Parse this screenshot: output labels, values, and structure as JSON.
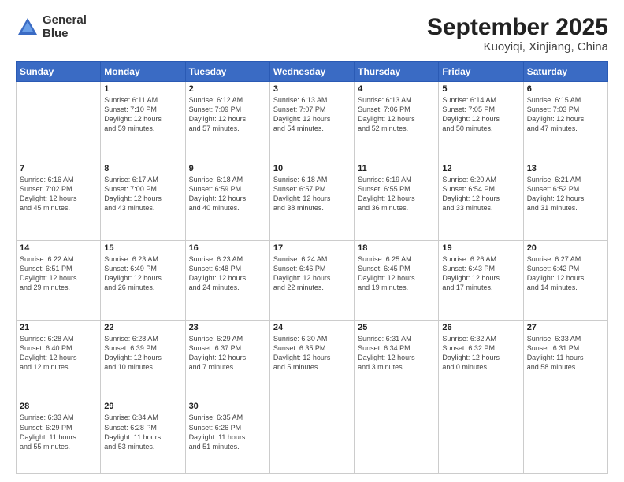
{
  "header": {
    "logo_line1": "General",
    "logo_line2": "Blue",
    "title": "September 2025",
    "subtitle": "Kuoyiqi, Xinjiang, China"
  },
  "days_of_week": [
    "Sunday",
    "Monday",
    "Tuesday",
    "Wednesday",
    "Thursday",
    "Friday",
    "Saturday"
  ],
  "weeks": [
    [
      {
        "day": "",
        "info": ""
      },
      {
        "day": "1",
        "info": "Sunrise: 6:11 AM\nSunset: 7:10 PM\nDaylight: 12 hours\nand 59 minutes."
      },
      {
        "day": "2",
        "info": "Sunrise: 6:12 AM\nSunset: 7:09 PM\nDaylight: 12 hours\nand 57 minutes."
      },
      {
        "day": "3",
        "info": "Sunrise: 6:13 AM\nSunset: 7:07 PM\nDaylight: 12 hours\nand 54 minutes."
      },
      {
        "day": "4",
        "info": "Sunrise: 6:13 AM\nSunset: 7:06 PM\nDaylight: 12 hours\nand 52 minutes."
      },
      {
        "day": "5",
        "info": "Sunrise: 6:14 AM\nSunset: 7:05 PM\nDaylight: 12 hours\nand 50 minutes."
      },
      {
        "day": "6",
        "info": "Sunrise: 6:15 AM\nSunset: 7:03 PM\nDaylight: 12 hours\nand 47 minutes."
      }
    ],
    [
      {
        "day": "7",
        "info": "Sunrise: 6:16 AM\nSunset: 7:02 PM\nDaylight: 12 hours\nand 45 minutes."
      },
      {
        "day": "8",
        "info": "Sunrise: 6:17 AM\nSunset: 7:00 PM\nDaylight: 12 hours\nand 43 minutes."
      },
      {
        "day": "9",
        "info": "Sunrise: 6:18 AM\nSunset: 6:59 PM\nDaylight: 12 hours\nand 40 minutes."
      },
      {
        "day": "10",
        "info": "Sunrise: 6:18 AM\nSunset: 6:57 PM\nDaylight: 12 hours\nand 38 minutes."
      },
      {
        "day": "11",
        "info": "Sunrise: 6:19 AM\nSunset: 6:55 PM\nDaylight: 12 hours\nand 36 minutes."
      },
      {
        "day": "12",
        "info": "Sunrise: 6:20 AM\nSunset: 6:54 PM\nDaylight: 12 hours\nand 33 minutes."
      },
      {
        "day": "13",
        "info": "Sunrise: 6:21 AM\nSunset: 6:52 PM\nDaylight: 12 hours\nand 31 minutes."
      }
    ],
    [
      {
        "day": "14",
        "info": "Sunrise: 6:22 AM\nSunset: 6:51 PM\nDaylight: 12 hours\nand 29 minutes."
      },
      {
        "day": "15",
        "info": "Sunrise: 6:23 AM\nSunset: 6:49 PM\nDaylight: 12 hours\nand 26 minutes."
      },
      {
        "day": "16",
        "info": "Sunrise: 6:23 AM\nSunset: 6:48 PM\nDaylight: 12 hours\nand 24 minutes."
      },
      {
        "day": "17",
        "info": "Sunrise: 6:24 AM\nSunset: 6:46 PM\nDaylight: 12 hours\nand 22 minutes."
      },
      {
        "day": "18",
        "info": "Sunrise: 6:25 AM\nSunset: 6:45 PM\nDaylight: 12 hours\nand 19 minutes."
      },
      {
        "day": "19",
        "info": "Sunrise: 6:26 AM\nSunset: 6:43 PM\nDaylight: 12 hours\nand 17 minutes."
      },
      {
        "day": "20",
        "info": "Sunrise: 6:27 AM\nSunset: 6:42 PM\nDaylight: 12 hours\nand 14 minutes."
      }
    ],
    [
      {
        "day": "21",
        "info": "Sunrise: 6:28 AM\nSunset: 6:40 PM\nDaylight: 12 hours\nand 12 minutes."
      },
      {
        "day": "22",
        "info": "Sunrise: 6:28 AM\nSunset: 6:39 PM\nDaylight: 12 hours\nand 10 minutes."
      },
      {
        "day": "23",
        "info": "Sunrise: 6:29 AM\nSunset: 6:37 PM\nDaylight: 12 hours\nand 7 minutes."
      },
      {
        "day": "24",
        "info": "Sunrise: 6:30 AM\nSunset: 6:35 PM\nDaylight: 12 hours\nand 5 minutes."
      },
      {
        "day": "25",
        "info": "Sunrise: 6:31 AM\nSunset: 6:34 PM\nDaylight: 12 hours\nand 3 minutes."
      },
      {
        "day": "26",
        "info": "Sunrise: 6:32 AM\nSunset: 6:32 PM\nDaylight: 12 hours\nand 0 minutes."
      },
      {
        "day": "27",
        "info": "Sunrise: 6:33 AM\nSunset: 6:31 PM\nDaylight: 11 hours\nand 58 minutes."
      }
    ],
    [
      {
        "day": "28",
        "info": "Sunrise: 6:33 AM\nSunset: 6:29 PM\nDaylight: 11 hours\nand 55 minutes."
      },
      {
        "day": "29",
        "info": "Sunrise: 6:34 AM\nSunset: 6:28 PM\nDaylight: 11 hours\nand 53 minutes."
      },
      {
        "day": "30",
        "info": "Sunrise: 6:35 AM\nSunset: 6:26 PM\nDaylight: 11 hours\nand 51 minutes."
      },
      {
        "day": "",
        "info": ""
      },
      {
        "day": "",
        "info": ""
      },
      {
        "day": "",
        "info": ""
      },
      {
        "day": "",
        "info": ""
      }
    ]
  ]
}
